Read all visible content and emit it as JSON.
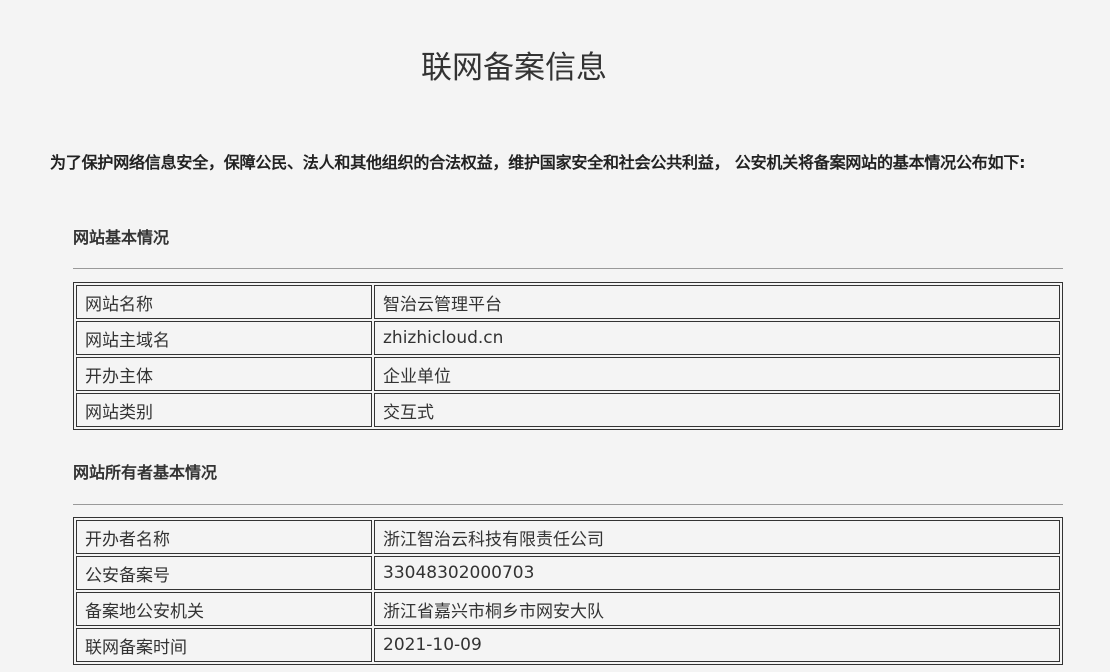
{
  "title": "联网备案信息",
  "intro": "为了保护网络信息安全，保障公民、法人和其他组织的合法权益，维护国家安全和社会公共利益， 公安机关将备案网站的基本情况公布如下:",
  "website_section": {
    "heading": "网站基本情况",
    "rows": [
      {
        "label": "网站名称",
        "value": "智治云管理平台"
      },
      {
        "label": "网站主域名",
        "value": "zhizhicloud.cn"
      },
      {
        "label": "开办主体",
        "value": "企业单位"
      },
      {
        "label": "网站类别",
        "value": "交互式"
      }
    ]
  },
  "owner_section": {
    "heading": "网站所有者基本情况",
    "rows": [
      {
        "label": "开办者名称",
        "value": "浙江智治云科技有限责任公司"
      },
      {
        "label": "公安备案号",
        "value": "33048302000703"
      },
      {
        "label": "备案地公安机关",
        "value": "浙江省嘉兴市桐乡市网安大队"
      },
      {
        "label": "联网备案时间",
        "value": "2021-10-09"
      }
    ]
  }
}
